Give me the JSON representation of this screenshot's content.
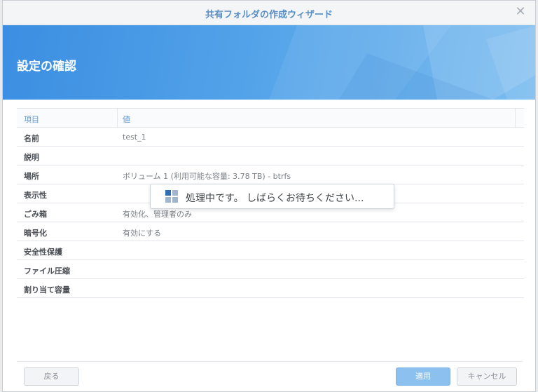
{
  "window": {
    "title": "共有フォルダの作成ウィザード"
  },
  "banner": {
    "title": "設定の確認"
  },
  "table": {
    "headers": {
      "key": "項目",
      "value": "値"
    },
    "rows": [
      {
        "key": "名前",
        "value": "test_1"
      },
      {
        "key": "説明",
        "value": ""
      },
      {
        "key": "場所",
        "value": "ボリューム 1 (利用可能な容量: 3.78 TB) - btrfs"
      },
      {
        "key": "表示性",
        "value": ""
      },
      {
        "key": "ごみ箱",
        "value": "有効化、管理者のみ"
      },
      {
        "key": "暗号化",
        "value": "有効にする"
      },
      {
        "key": "安全性保護",
        "value": ""
      },
      {
        "key": "ファイル圧縮",
        "value": ""
      },
      {
        "key": "割り当て容量",
        "value": ""
      }
    ]
  },
  "loading": {
    "text": "処理中です。 しばらくお待ちください..."
  },
  "buttons": {
    "back": "戻る",
    "apply": "適用",
    "cancel": "キャンセル"
  },
  "colors": {
    "accent": "#5b8ec4",
    "banner": "#52a2e9",
    "apply": "#8cc0ef"
  },
  "icons": {
    "close": "close-icon",
    "loading": "loading-spinner-icon"
  }
}
